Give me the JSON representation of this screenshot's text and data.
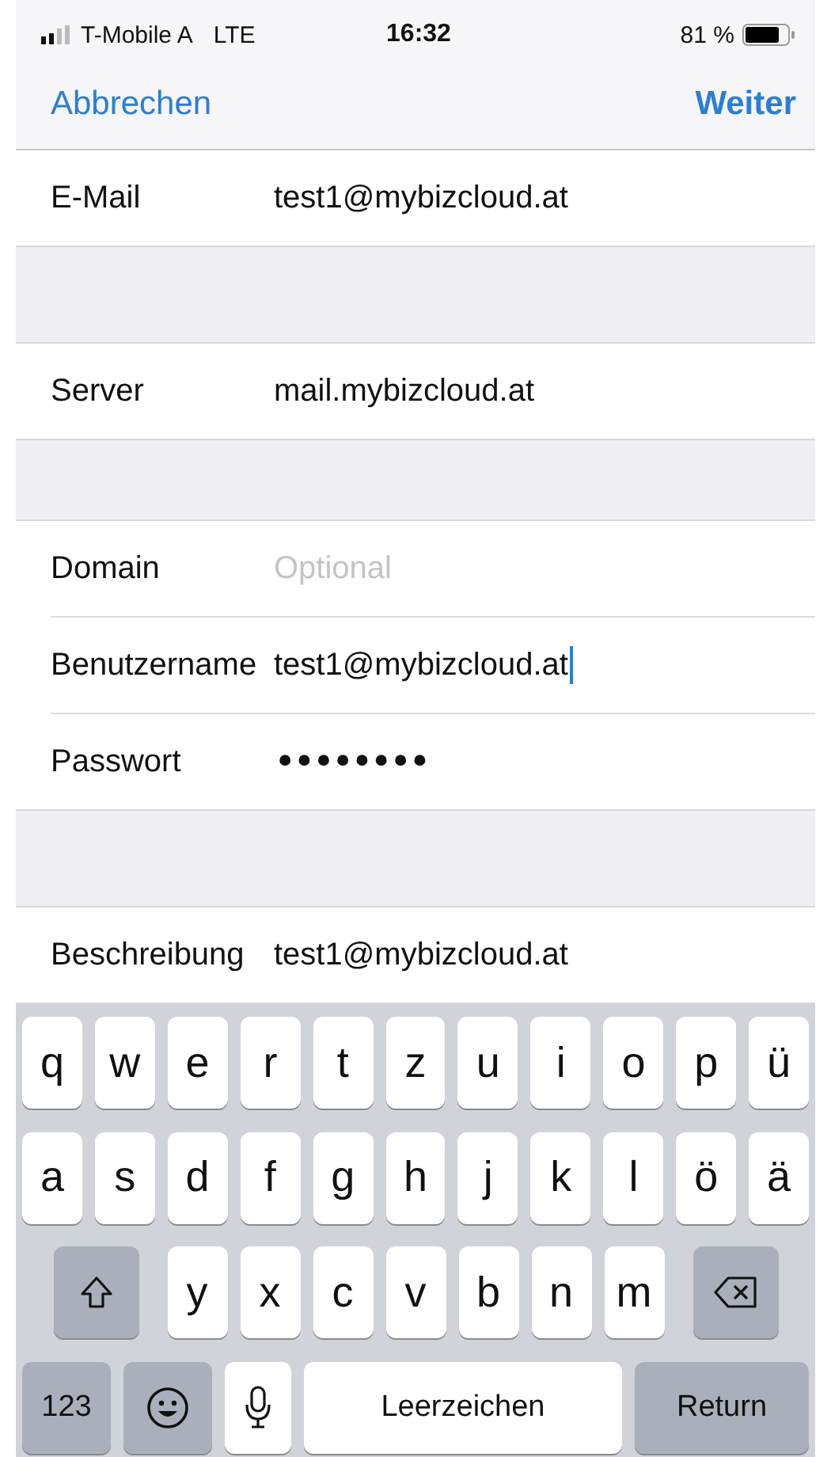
{
  "status_bar": {
    "carrier": "T-Mobile A",
    "network": "LTE",
    "time": "16:32",
    "battery_text": "81 %"
  },
  "nav": {
    "cancel": "Abbrechen",
    "next": "Weiter"
  },
  "sections": [
    {
      "rows": [
        {
          "label": "E-Mail",
          "value": "test1@mybizcloud.at",
          "focused": false
        }
      ]
    },
    {
      "rows": [
        {
          "label": "Server",
          "value": "mail.mybizcloud.at",
          "focused": false
        }
      ]
    },
    {
      "rows": [
        {
          "label": "Domain",
          "placeholder": "Optional",
          "focused": false
        },
        {
          "label": "Benutzername",
          "value": "test1@mybizcloud.at",
          "focused": true
        },
        {
          "label": "Passwort",
          "value": "••••••••",
          "focused": false,
          "kind": "password"
        }
      ]
    },
    {
      "rows": [
        {
          "label": "Beschreibung",
          "value": "test1@mybizcloud.at",
          "focused": false
        }
      ]
    }
  ],
  "keyboard": [
    [
      {
        "kind": "letter",
        "label": "q"
      },
      {
        "kind": "letter",
        "label": "w"
      },
      {
        "kind": "letter",
        "label": "e"
      },
      {
        "kind": "letter",
        "label": "r"
      },
      {
        "kind": "letter",
        "label": "t"
      },
      {
        "kind": "letter",
        "label": "z"
      },
      {
        "kind": "letter",
        "label": "u"
      },
      {
        "kind": "letter",
        "label": "i"
      },
      {
        "kind": "letter",
        "label": "o"
      },
      {
        "kind": "letter",
        "label": "p"
      },
      {
        "kind": "letter",
        "label": "ü"
      }
    ],
    [
      {
        "kind": "letter",
        "label": "a"
      },
      {
        "kind": "letter",
        "label": "s"
      },
      {
        "kind": "letter",
        "label": "d"
      },
      {
        "kind": "letter",
        "label": "f"
      },
      {
        "kind": "letter",
        "label": "g"
      },
      {
        "kind": "letter",
        "label": "h"
      },
      {
        "kind": "letter",
        "label": "j"
      },
      {
        "kind": "letter",
        "label": "k"
      },
      {
        "kind": "letter",
        "label": "l"
      },
      {
        "kind": "letter",
        "label": "ö"
      },
      {
        "kind": "letter",
        "label": "ä"
      }
    ],
    [
      {
        "kind": "shift"
      },
      {
        "kind": "letter",
        "label": "y"
      },
      {
        "kind": "letter",
        "label": "x"
      },
      {
        "kind": "letter",
        "label": "c"
      },
      {
        "kind": "letter",
        "label": "v"
      },
      {
        "kind": "letter",
        "label": "b"
      },
      {
        "kind": "letter",
        "label": "n"
      },
      {
        "kind": "letter",
        "label": "m"
      },
      {
        "kind": "backspace"
      }
    ],
    [
      {
        "kind": "numbers",
        "label": "123"
      },
      {
        "kind": "emoji"
      },
      {
        "kind": "mic"
      },
      {
        "kind": "space",
        "label": "Leerzeichen"
      },
      {
        "kind": "return",
        "label": "Return"
      }
    ]
  ]
}
